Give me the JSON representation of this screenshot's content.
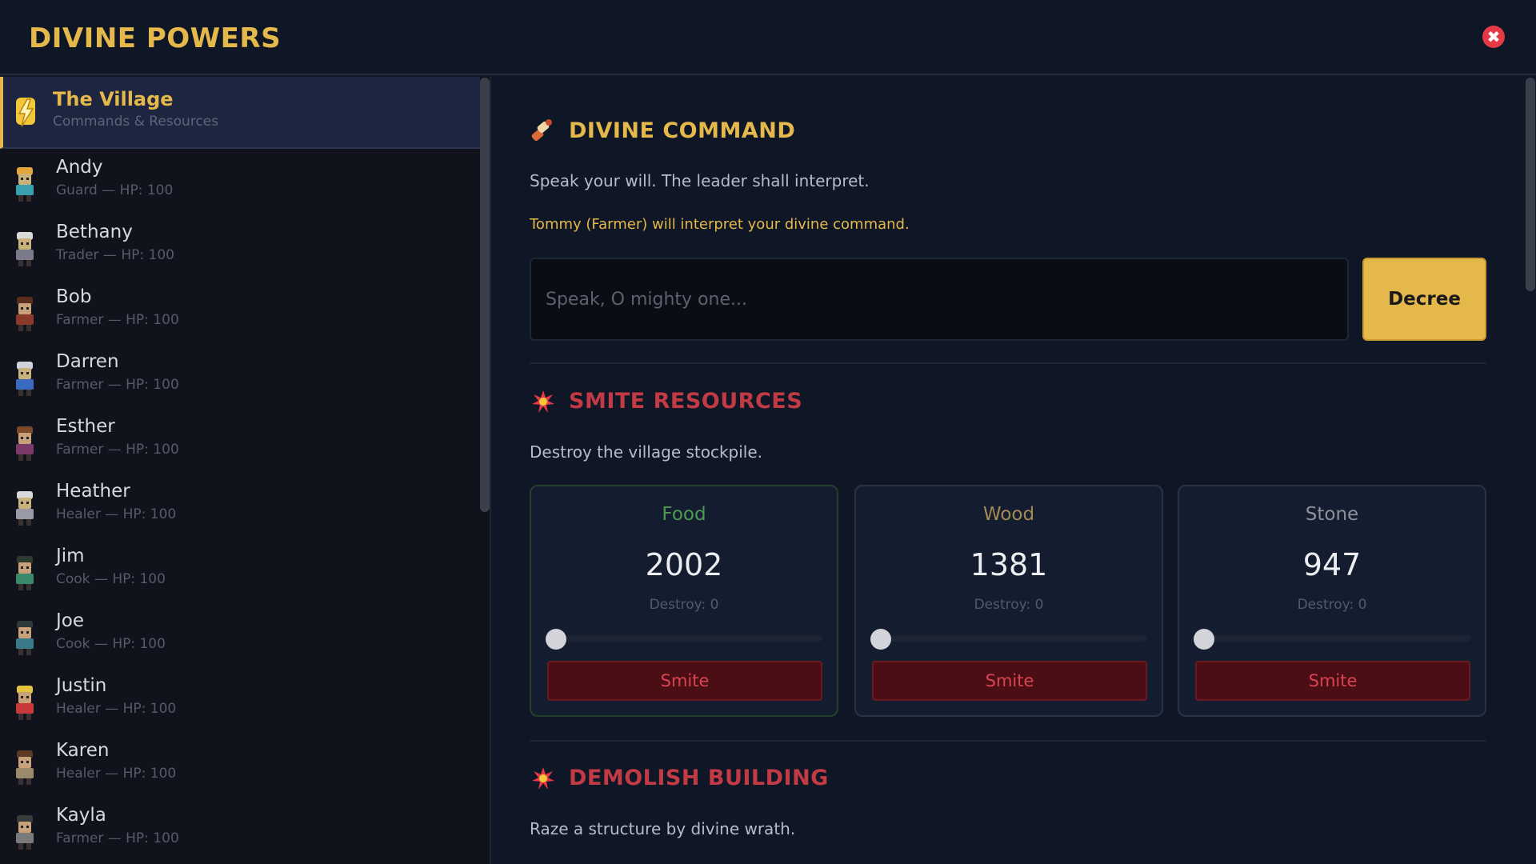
{
  "header": {
    "title": "DIVINE POWERS",
    "close_label": "✖"
  },
  "sidebar": {
    "village": {
      "name": "The Village",
      "subtitle": "Commands & Resources"
    },
    "villagers": [
      {
        "name": "Andy",
        "info": "Guard — HP: 100",
        "colors": [
          "#e4a53a",
          "#c8b27a",
          "#3aa0b0"
        ]
      },
      {
        "name": "Bethany",
        "info": "Trader — HP: 100",
        "colors": [
          "#d9d9d9",
          "#c8b27a",
          "#7a7a8a"
        ]
      },
      {
        "name": "Bob",
        "info": "Farmer — HP: 100",
        "colors": [
          "#5a2e1c",
          "#c8a07a",
          "#8a3a2a"
        ]
      },
      {
        "name": "Darren",
        "info": "Farmer — HP: 100",
        "colors": [
          "#cfd4dc",
          "#c8b27a",
          "#3a6ac0"
        ]
      },
      {
        "name": "Esther",
        "info": "Farmer — HP: 100",
        "colors": [
          "#7a4a2a",
          "#c8a07a",
          "#7a3a6a"
        ]
      },
      {
        "name": "Heather",
        "info": "Healer — HP: 100",
        "colors": [
          "#d9d9d9",
          "#c8b27a",
          "#9a9aa6"
        ]
      },
      {
        "name": "Jim",
        "info": "Cook — HP: 100",
        "colors": [
          "#2e3a2e",
          "#c8a07a",
          "#3a8a6a"
        ]
      },
      {
        "name": "Joe",
        "info": "Cook — HP: 100",
        "colors": [
          "#2e3a3a",
          "#c8a07a",
          "#3a7a8a"
        ]
      },
      {
        "name": "Justin",
        "info": "Healer — HP: 100",
        "colors": [
          "#e4c43a",
          "#c8a07a",
          "#c83a3a"
        ]
      },
      {
        "name": "Karen",
        "info": "Healer — HP: 100",
        "colors": [
          "#5a3a22",
          "#c8a07a",
          "#9a8a6a"
        ]
      },
      {
        "name": "Kayla",
        "info": "Farmer — HP: 100",
        "colors": [
          "#3a3a3a",
          "#c8a07a",
          "#7a7a7a"
        ]
      }
    ]
  },
  "command": {
    "title": "DIVINE COMMAND",
    "description": "Speak your will. The leader shall interpret.",
    "interpreter": "Tommy (Farmer) will interpret your divine command.",
    "input_placeholder": "Speak, O mighty one...",
    "decree_label": "Decree"
  },
  "smite": {
    "title": "SMITE RESOURCES",
    "description": "Destroy the village stockpile.",
    "resources": [
      {
        "name": "Food",
        "value": "2002",
        "destroy": "Destroy: 0",
        "slider_level": 0,
        "button": "Smite",
        "color": "#4e9a52"
      },
      {
        "name": "Wood",
        "value": "1381",
        "destroy": "Destroy: 0",
        "slider_level": 0,
        "button": "Smite",
        "color": "#a38a55"
      },
      {
        "name": "Stone",
        "value": "947",
        "destroy": "Destroy: 0",
        "slider_level": 0,
        "button": "Smite",
        "color": "#8c919a"
      }
    ]
  },
  "demolish": {
    "title": "DEMOLISH BUILDING",
    "description": "Raze a structure by divine wrath."
  },
  "colors": {
    "accent": "#e4b84a",
    "danger": "#d94452",
    "background": "#0f1626"
  }
}
